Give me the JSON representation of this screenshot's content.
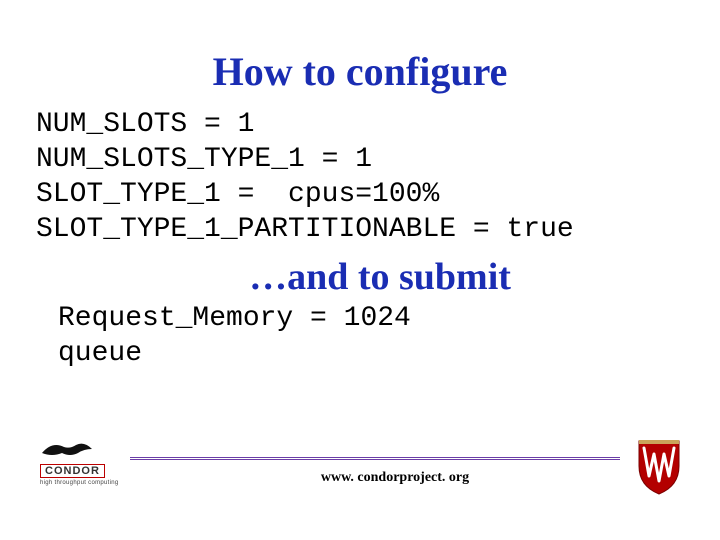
{
  "title1": "How to configure",
  "config_lines": "NUM_SLOTS = 1\nNUM_SLOTS_TYPE_1 = 1\nSLOT_TYPE_1 =  cpus=100%\nSLOT_TYPE_1_PARTITIONABLE = true",
  "title2": "…and to submit",
  "submit_lines": "Request_Memory = 1024\nqueue",
  "footer": {
    "condor_text": "CONDOR",
    "condor_tag": "high throughput computing",
    "url": "www. condorproject. org"
  }
}
